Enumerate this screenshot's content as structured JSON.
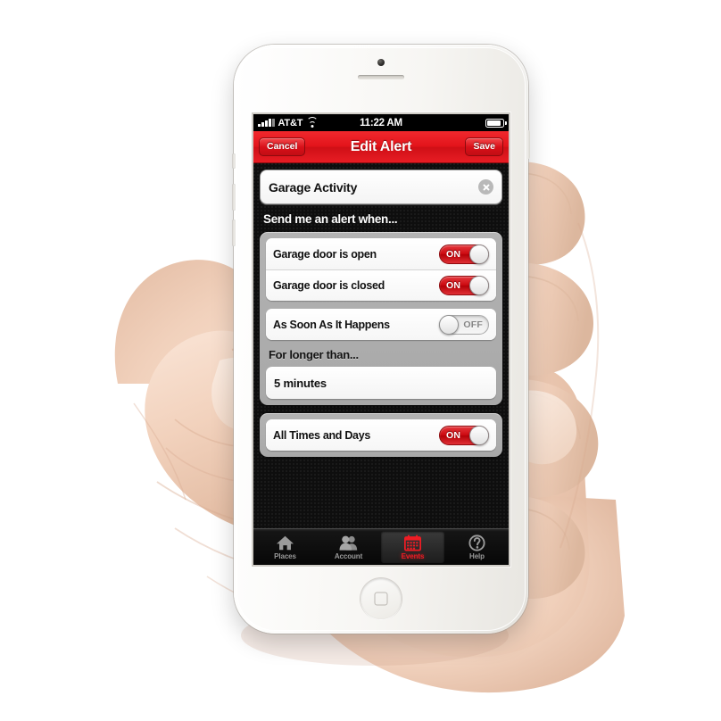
{
  "device": {
    "kind": "white-smartphone-in-hand"
  },
  "status_bar": {
    "carrier": "AT&T",
    "time": "11:22 AM",
    "signal_icon": "signal-bars-icon",
    "wifi_icon": "wifi-icon",
    "battery_icon": "battery-icon"
  },
  "nav_bar": {
    "title": "Edit Alert",
    "cancel_label": "Cancel",
    "save_label": "Save",
    "color": "#e3141b"
  },
  "alert_name_field": {
    "value": "Garage Activity",
    "clear_icon": "clear-circle-icon"
  },
  "section_header": "Send me an alert when...",
  "trigger_rows": [
    {
      "label": "Garage door is open",
      "state": "ON"
    },
    {
      "label": "Garage door is closed",
      "state": "ON"
    }
  ],
  "timing_row": {
    "label": "As Soon As It Happens",
    "state": "OFF"
  },
  "duration": {
    "label": "For longer than...",
    "value": "5 minutes"
  },
  "schedule_row": {
    "label": "All Times and Days",
    "state": "ON"
  },
  "tab_bar": {
    "items": [
      {
        "label": "Places",
        "icon": "home-icon",
        "active": false
      },
      {
        "label": "Account",
        "icon": "people-icon",
        "active": false
      },
      {
        "label": "Events",
        "icon": "calendar-icon",
        "active": true
      },
      {
        "label": "Help",
        "icon": "question-mark-icon",
        "active": false
      }
    ],
    "active_color": "#ee1c24"
  }
}
